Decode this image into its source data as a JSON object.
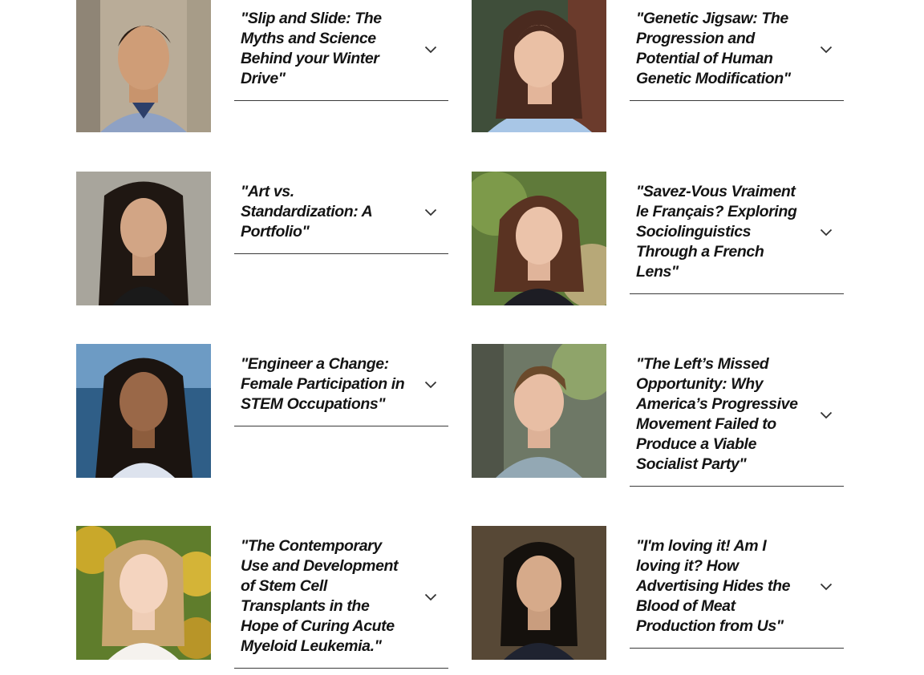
{
  "projects": [
    {
      "title": "\"Slip and Slide: The Myths and Science Behind your Winter Drive\"",
      "photo": "student-portrait-photo",
      "icon": "chevron-down-icon"
    },
    {
      "title": "\"Genetic Jigsaw: The Progression and Potential of Human Genetic Modification\"",
      "photo": "student-portrait-photo",
      "icon": "chevron-down-icon"
    },
    {
      "title": "\"Art vs. Standardization: A Portfolio\"",
      "photo": "student-portrait-photo",
      "icon": "chevron-down-icon"
    },
    {
      "title": "\"Savez-Vous Vraiment le Français? Exploring Sociolinguistics Through a French Lens\"",
      "photo": "student-portrait-photo",
      "icon": "chevron-down-icon"
    },
    {
      "title": "\"Engineer a Change: Female Participation in STEM Occupations\"",
      "photo": "student-portrait-photo",
      "icon": "chevron-down-icon"
    },
    {
      "title": "\"The Left’s Missed Opportunity: Why America’s Progressive Movement Failed to Produce a Viable Socialist Party\"",
      "photo": "student-portrait-photo",
      "icon": "chevron-down-icon"
    },
    {
      "title": "\"The Contemporary Use and Development of Stem Cell Transplants in the Hope of Curing Acute Myeloid Leukemia.\"",
      "photo": "student-portrait-photo",
      "icon": "chevron-down-icon"
    },
    {
      "title": "\"I'm loving it! Am I loving it? How Advertising Hides the Blood of Meat Production from Us\"",
      "photo": "student-portrait-photo",
      "icon": "chevron-down-icon"
    }
  ]
}
